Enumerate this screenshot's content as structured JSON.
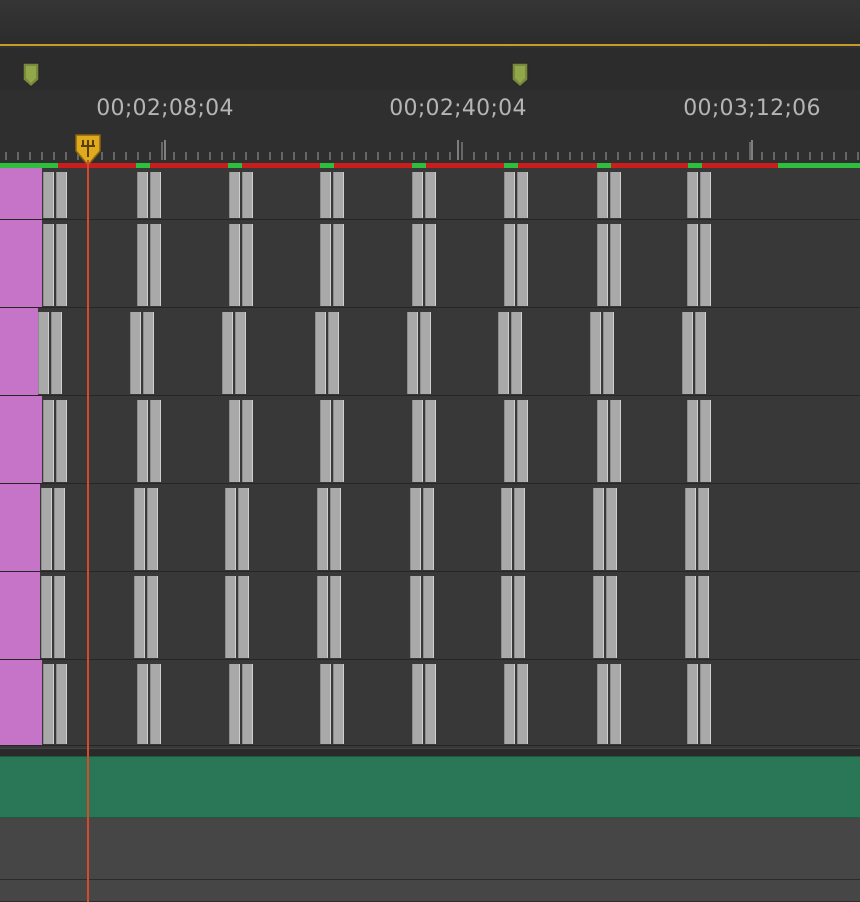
{
  "timeline": {
    "labels": [
      "00;02;08;04",
      "00;02;40;04",
      "00;03;12;06"
    ],
    "playhead_icon": "playhead-marker-icon",
    "zoom_handle_icon": "zoom-handle-icon"
  },
  "colors": {
    "playhead": "#d64a2c",
    "playhead_head": "#e0aa1e",
    "video_clip": "#c574c8",
    "audio_clip": "#2a7757",
    "render_red": "#c81e1e",
    "render_green": "#2fbf3f",
    "work_area": "#c79a2a"
  }
}
